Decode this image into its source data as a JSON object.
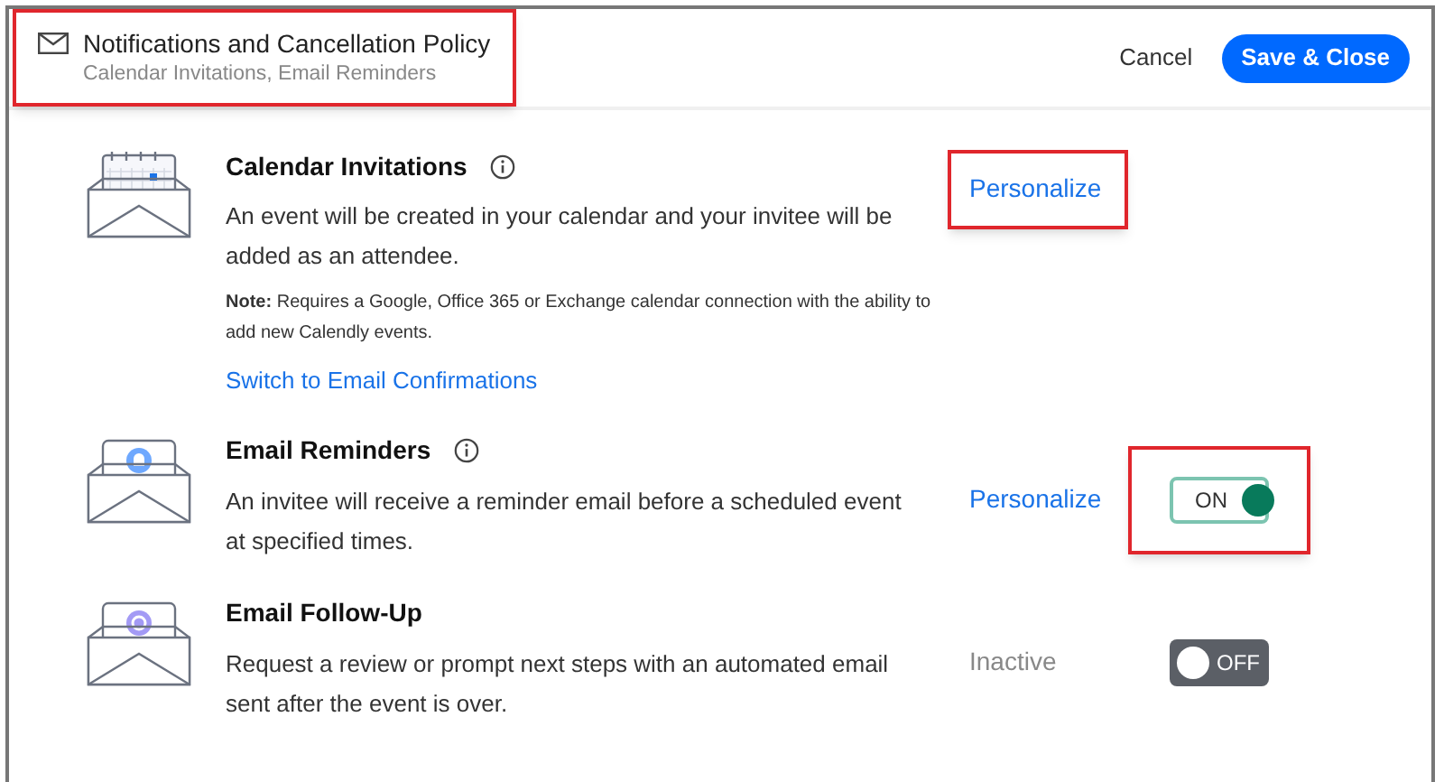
{
  "header": {
    "title": "Notifications and Cancellation Policy",
    "subtitle": "Calendar Invitations, Email Reminders",
    "highlighted": true,
    "cancel": "Cancel",
    "save": "Save & Close"
  },
  "sections": [
    {
      "kind": "calendar",
      "title": "Calendar Invitations",
      "info": true,
      "description": "An event will be created in your calendar and your invitee will be added as an attendee.",
      "note": "**Note:** Requires a Google, Office 365 or Exchange calendar connection with the ability to add new Calendly events.",
      "link": "Switch to Email Confirmations",
      "action": {
        "kind": "link",
        "label": "Personalize",
        "highlighted": true
      }
    },
    {
      "kind": "bell",
      "title": "Email Reminders",
      "info": true,
      "description": "An invitee will receive a reminder email before a scheduled event at specified times.",
      "action": {
        "kind": "link",
        "label": "Personalize",
        "highlighted": false
      },
      "toggle": {
        "on": true,
        "label": "ON",
        "highlighted": true
      }
    },
    {
      "kind": "refresh",
      "title": "Email Follow-Up",
      "info": false,
      "description": "Request a review or prompt next steps with an automated email sent after the event is over.",
      "action": {
        "kind": "status",
        "label": "Inactive",
        "highlighted": false
      },
      "toggle": {
        "on": false,
        "label": "OFF",
        "highlighted": false
      }
    }
  ]
}
